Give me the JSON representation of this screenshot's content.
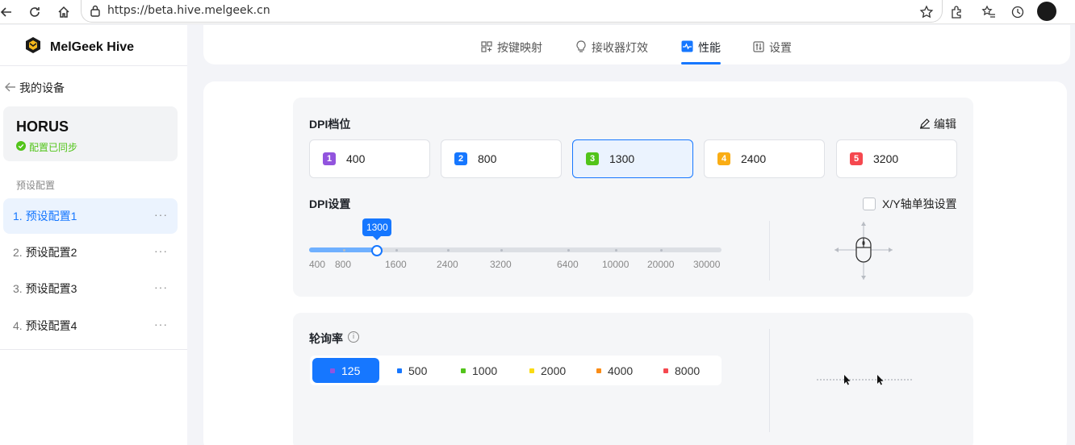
{
  "browser": {
    "url": "https://beta.hive.melgeek.cn"
  },
  "sidebar": {
    "brand": "MelGeek Hive",
    "back_label": "我的设备",
    "device_name": "HORUS",
    "sync_status": "配置已同步",
    "preset_header": "预设配置",
    "presets": [
      {
        "index": "1.",
        "label": "预设配置1",
        "active": true
      },
      {
        "index": "2.",
        "label": "预设配置2",
        "active": false
      },
      {
        "index": "3.",
        "label": "预设配置3",
        "active": false
      },
      {
        "index": "4.",
        "label": "预设配置4",
        "active": false
      }
    ],
    "more_label": "···"
  },
  "tabs": [
    {
      "label": "按键映射",
      "icon": "keymap-icon"
    },
    {
      "label": "接收器灯效",
      "icon": "bulb-icon"
    },
    {
      "label": "性能",
      "icon": "performance-icon",
      "active": true
    },
    {
      "label": "设置",
      "icon": "settings-icon"
    }
  ],
  "dpi_levels": {
    "title": "DPI档位",
    "edit_label": "编辑",
    "items": [
      {
        "num": "1",
        "value": "400",
        "color": "#9254de"
      },
      {
        "num": "2",
        "value": "800",
        "color": "#1677ff"
      },
      {
        "num": "3",
        "value": "1300",
        "color": "#52c41a",
        "active": true
      },
      {
        "num": "4",
        "value": "2400",
        "color": "#faad14"
      },
      {
        "num": "5",
        "value": "3200",
        "color": "#f5484f"
      }
    ]
  },
  "dpi_settings": {
    "title": "DPI设置",
    "xy_label": "X/Y轴单独设置",
    "xy_checked": false,
    "current_value": "1300",
    "progress_fraction": 0.165,
    "tick_labels": [
      "400",
      "800",
      "1600",
      "2400",
      "3200",
      "6400",
      "10000",
      "20000",
      "30000"
    ]
  },
  "polling": {
    "title": "轮询率",
    "info_icon": "info-icon",
    "options": [
      {
        "value": "125",
        "color": "#9254de",
        "active": true
      },
      {
        "value": "500",
        "color": "#1677ff"
      },
      {
        "value": "1000",
        "color": "#52c41a"
      },
      {
        "value": "2000",
        "color": "#fadb14"
      },
      {
        "value": "4000",
        "color": "#fa8c16"
      },
      {
        "value": "8000",
        "color": "#f5484f"
      }
    ]
  }
}
